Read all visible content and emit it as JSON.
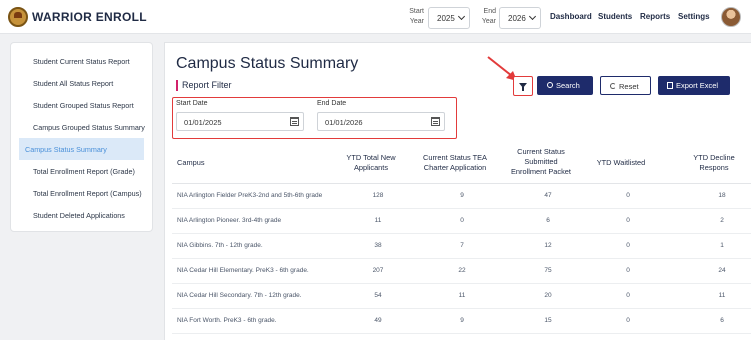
{
  "header": {
    "brand": "WARRIOR ENROLL",
    "start_year_label": [
      "Start",
      "Year"
    ],
    "start_year": "2025",
    "end_year_label": [
      "End",
      "Year"
    ],
    "end_year": "2026",
    "nav": [
      "Dashboard",
      "Students",
      "Reports",
      "Settings"
    ]
  },
  "sidebar": {
    "items": [
      {
        "label": "Student Current Status Report"
      },
      {
        "label": "Student All Status Report"
      },
      {
        "label": "Student Grouped Status Report"
      },
      {
        "label": "Campus Grouped Status Summary"
      },
      {
        "label": "Campus Status Summary"
      },
      {
        "label": "Total Enrollment Report (Grade)"
      },
      {
        "label": "Total Enrollment Report (Campus)"
      },
      {
        "label": "Student Deleted Applications"
      }
    ],
    "active_index": 4
  },
  "main": {
    "title": "Campus Status Summary",
    "filter_label": "Report Filter",
    "start_date_label": "Start Date",
    "start_date": "01/01/2025",
    "end_date_label": "End Date",
    "end_date": "01/01/2026",
    "search_label": "Search",
    "reset_label": "Reset",
    "export_label": "Export Excel"
  },
  "table": {
    "columns": [
      [
        "Campus"
      ],
      [
        "YTD Total New",
        "Applicants"
      ],
      [
        "Current Status TEA",
        "Charter Application"
      ],
      [
        "Current Status",
        "Submitted",
        "Enrollment Packet"
      ],
      [
        "YTD Waitlisted"
      ],
      [
        "YTD Decline",
        "Respons"
      ]
    ],
    "rows": [
      [
        "NIA Arlington Fielder PreK3-2nd and 5th-6th grade",
        "128",
        "9",
        "47",
        "0",
        "18"
      ],
      [
        "NIA Arlington Pioneer. 3rd-4th grade",
        "11",
        "0",
        "6",
        "0",
        "2"
      ],
      [
        "NIA Gibbins. 7th - 12th grade.",
        "38",
        "7",
        "12",
        "0",
        "1"
      ],
      [
        "NIA Cedar Hill Elementary. PreK3 - 6th grade.",
        "207",
        "22",
        "75",
        "0",
        "24"
      ],
      [
        "NIA Cedar Hill Secondary. 7th - 12th grade.",
        "54",
        "11",
        "20",
        "0",
        "11"
      ],
      [
        "NIA Fort Worth. PreK3 - 6th grade.",
        "49",
        "9",
        "15",
        "0",
        "6"
      ]
    ]
  },
  "colors": {
    "primary": "#1e2b6b",
    "highlight": "#e23b3b",
    "active_bg": "#dbe9f8",
    "active_text": "#4a90d9"
  }
}
